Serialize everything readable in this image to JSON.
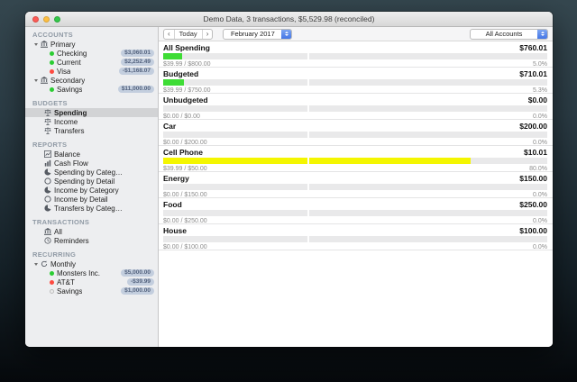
{
  "window": {
    "title": "Demo Data, 3 transactions, $5,529.98 (reconciled)"
  },
  "toolbar": {
    "prev_label": "‹",
    "today_label": "Today",
    "next_label": "›",
    "period_value": "February 2017",
    "accounts_filter_value": "All Accounts"
  },
  "sidebar": {
    "accounts": {
      "header": "ACCOUNTS",
      "primary": {
        "label": "Primary"
      },
      "checking": {
        "label": "Checking",
        "badge": "$3,060.01"
      },
      "current": {
        "label": "Current",
        "badge": "$2,252.49"
      },
      "visa": {
        "label": "Visa",
        "badge": "-$1,168.07"
      },
      "secondary": {
        "label": "Secondary"
      },
      "savings": {
        "label": "Savings",
        "badge": "$11,000.00"
      }
    },
    "budgets": {
      "header": "BUDGETS",
      "spending": {
        "label": "Spending"
      },
      "income": {
        "label": "Income"
      },
      "transfers": {
        "label": "Transfers"
      }
    },
    "reports": {
      "header": "REPORTS",
      "balance": {
        "label": "Balance"
      },
      "cash_flow": {
        "label": "Cash Flow"
      },
      "spending_by_category": {
        "label": "Spending by Categ…"
      },
      "spending_by_detail": {
        "label": "Spending by Detail"
      },
      "income_by_category": {
        "label": "Income by Category"
      },
      "income_by_detail": {
        "label": "Income by Detail"
      },
      "transfers_by_category": {
        "label": "Transfers by Categ…"
      }
    },
    "transactions": {
      "header": "TRANSACTIONS",
      "all": {
        "label": "All"
      },
      "reminders": {
        "label": "Reminders"
      }
    },
    "recurring": {
      "header": "RECURRING",
      "monthly": {
        "label": "Monthly"
      },
      "monsters": {
        "label": "Monsters Inc.",
        "badge": "$5,000.00"
      },
      "att": {
        "label": "AT&T",
        "badge": "-$39.99"
      },
      "savings": {
        "label": "Savings",
        "badge": "$1,000.00"
      }
    }
  },
  "budget_rows": [
    {
      "name": "All Spending",
      "amount": "$760.01",
      "detail": "$39.99 / $800.00",
      "percent_label": "5.0%",
      "percent": 5,
      "bar_color": "#3edc35"
    },
    {
      "name": "Budgeted",
      "amount": "$710.01",
      "detail": "$39.99 / $750.00",
      "percent_label": "5.3%",
      "percent": 5.3,
      "bar_color": "#3edc35"
    },
    {
      "name": "Unbudgeted",
      "amount": "$0.00",
      "detail": "$0.00 / $0.00",
      "percent_label": "0.0%",
      "percent": 0,
      "bar_color": "#3edc35"
    },
    {
      "name": "Car",
      "amount": "$200.00",
      "detail": "$0.00 / $200.00",
      "percent_label": "0.0%",
      "percent": 0,
      "bar_color": "#3edc35"
    },
    {
      "name": "Cell Phone",
      "amount": "$10.01",
      "detail": "$39.99 / $50.00",
      "percent_label": "80.0%",
      "percent": 80,
      "bar_color": "#f4f600"
    },
    {
      "name": "Energy",
      "amount": "$150.00",
      "detail": "$0.00 / $150.00",
      "percent_label": "0.0%",
      "percent": 0,
      "bar_color": "#3edc35"
    },
    {
      "name": "Food",
      "amount": "$250.00",
      "detail": "$0.00 / $250.00",
      "percent_label": "0.0%",
      "percent": 0,
      "bar_color": "#3edc35"
    },
    {
      "name": "House",
      "amount": "$100.00",
      "detail": "$0.00 / $100.00",
      "percent_label": "0.0%",
      "percent": 0,
      "bar_color": "#3edc35"
    }
  ],
  "colors": {
    "dot_green": "#2bcd33",
    "dot_red": "#fd4a40",
    "dot_gray": "#ececec",
    "badge_bg": "#c3cede",
    "badge_text": "#55647f",
    "tl_red": "#fc5b57",
    "tl_yellow": "#fdbe41",
    "tl_green": "#34c84a"
  }
}
